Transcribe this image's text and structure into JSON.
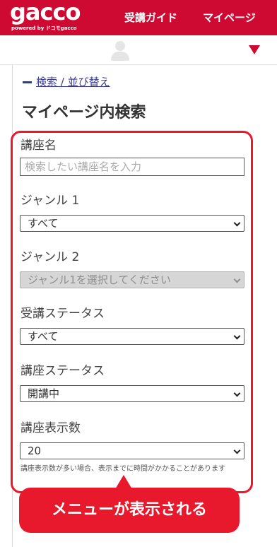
{
  "header": {
    "logo": "gacco",
    "logo_sub": "powered by ドコモgacco",
    "nav": [
      {
        "label": "受講ガイド"
      },
      {
        "label": "マイページ"
      }
    ],
    "brand_color": "#cf0a32"
  },
  "userbar": {
    "avatar_icon": "user-avatar-icon",
    "menu_icon": "caret-down-icon"
  },
  "search": {
    "toggle_label": "検索 / 並び替え",
    "title": "マイページ内検索",
    "course_name": {
      "label": "講座名",
      "placeholder": "検索したい講座名を入力"
    },
    "genre1": {
      "label": "ジャンル 1",
      "value": "すべて"
    },
    "genre2": {
      "label": "ジャンル 2",
      "value": "ジャンル1を選択してください"
    },
    "attendance_status": {
      "label": "受講ステータス",
      "value": "すべて"
    },
    "course_status": {
      "label": "講座ステータス",
      "value": "開講中"
    },
    "display_count": {
      "label": "講座表示数",
      "value": "20"
    },
    "note": "講座表示数が多い場合、表示までに時間がかかることがあります"
  },
  "callout": {
    "text": "メニューが表示される",
    "color": "#e8192c"
  }
}
